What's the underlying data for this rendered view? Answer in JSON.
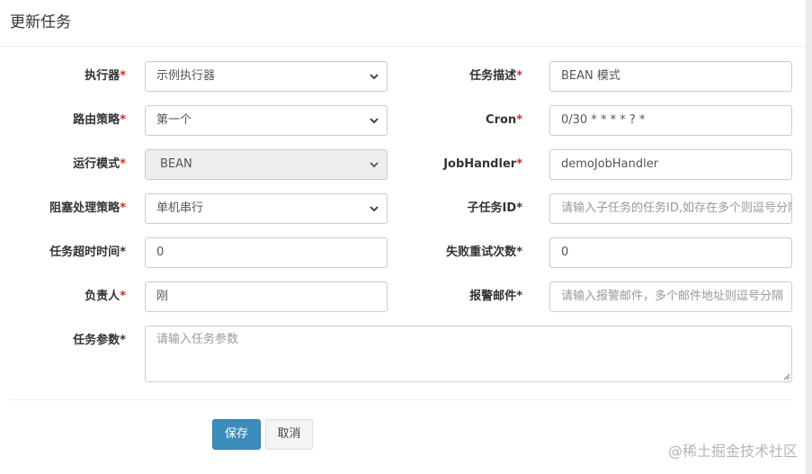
{
  "modal": {
    "title": "更新任务"
  },
  "form": {
    "executor": {
      "label": "执行器",
      "value": "示例执行器"
    },
    "task_desc": {
      "label": "任务描述",
      "value": "BEAN 模式"
    },
    "route_strategy": {
      "label": "路由策略",
      "value": "第一个"
    },
    "cron": {
      "label": "Cron",
      "value": "0/30 * * * * ? *"
    },
    "run_mode": {
      "label": "运行模式",
      "value": "BEAN"
    },
    "job_handler": {
      "label": "JobHandler",
      "value": "demoJobHandler"
    },
    "block_strategy": {
      "label": "阻塞处理策略",
      "value": "单机串行"
    },
    "child_job_id": {
      "label": "子任务ID",
      "placeholder": "请输入子任务的任务ID,如存在多个则逗号分隔"
    },
    "timeout": {
      "label": "任务超时时间",
      "value": "0"
    },
    "retry_count": {
      "label": "失败重试次数",
      "value": "0"
    },
    "author": {
      "label": "负责人",
      "value": "刚"
    },
    "alarm_email": {
      "label": "报警邮件",
      "placeholder": "请输入报警邮件，多个邮件地址则逗号分隔"
    },
    "params": {
      "label": "任务参数",
      "placeholder": "请输入任务参数"
    },
    "required_mark": "*"
  },
  "buttons": {
    "save": "保存",
    "cancel": "取消"
  },
  "watermark": "@稀土掘金技术社区",
  "colors": {
    "primary": "#3c8dbc",
    "required": "#c9302c"
  }
}
